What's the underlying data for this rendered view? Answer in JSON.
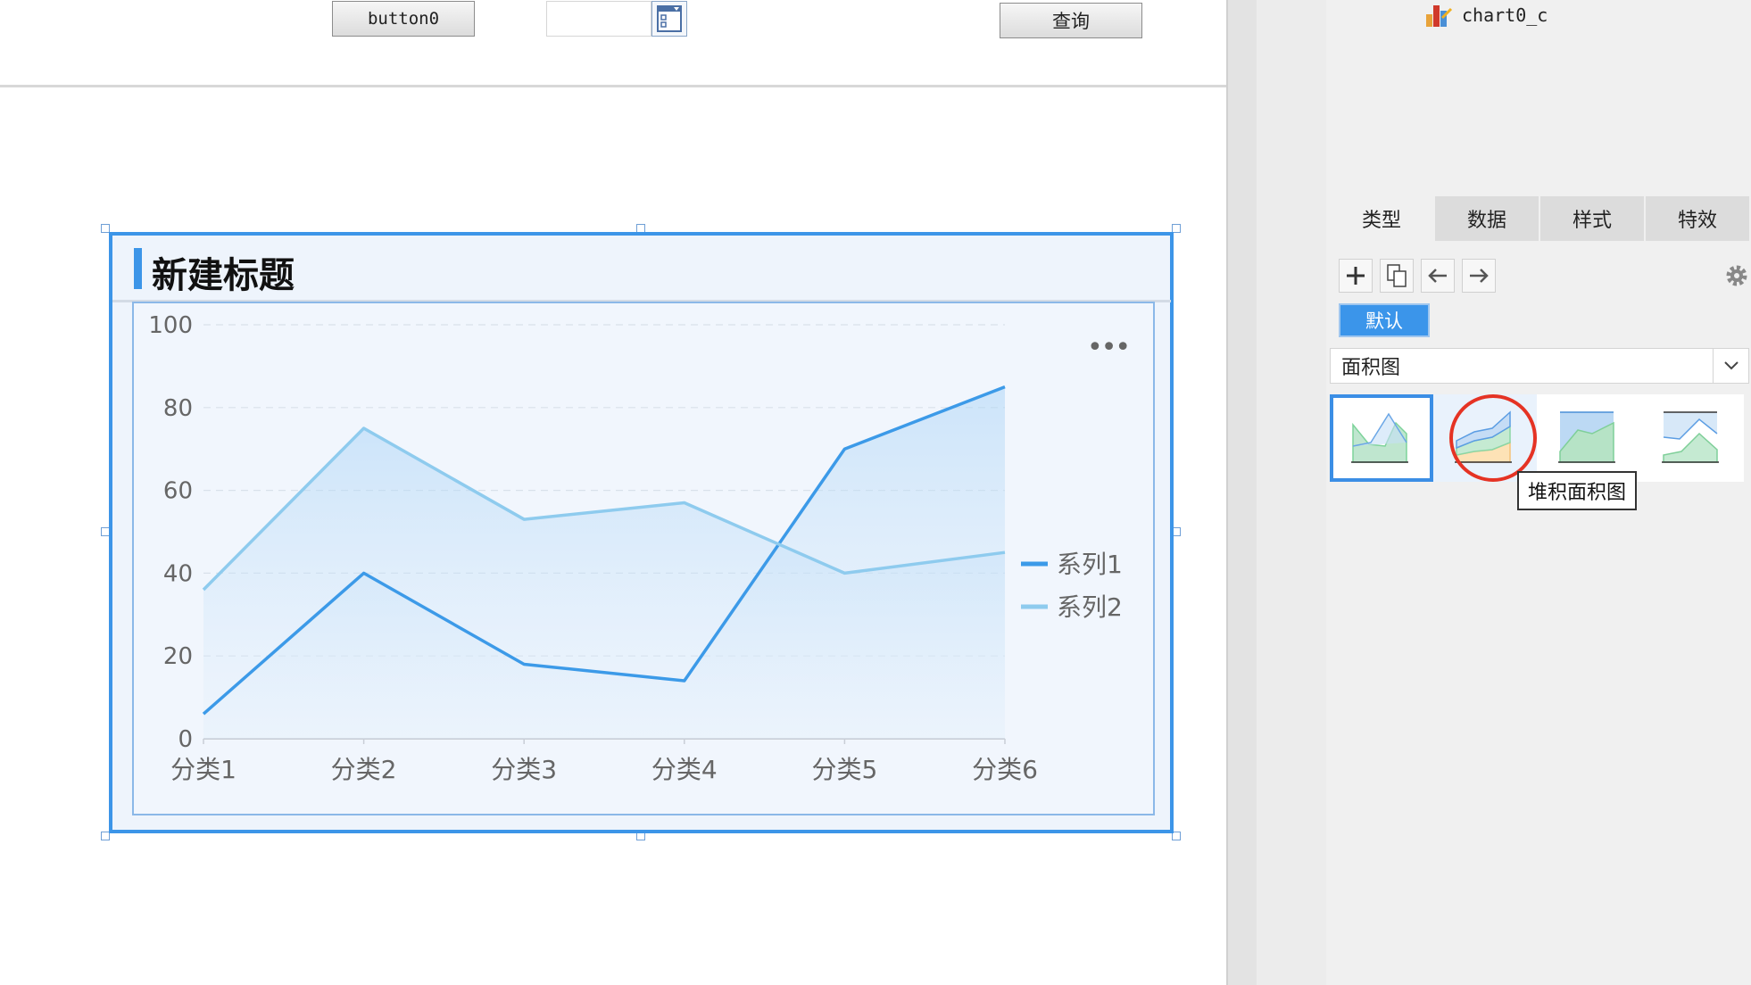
{
  "toolbar": {
    "button0_label": "button0",
    "query_label": "查询",
    "date_value": ""
  },
  "chart": {
    "title": "新建标题",
    "more_label": "•••"
  },
  "chart_data": {
    "type": "area",
    "categories": [
      "分类1",
      "分类2",
      "分类3",
      "分类4",
      "分类5",
      "分类6"
    ],
    "series": [
      {
        "name": "系列1",
        "values": [
          6,
          40,
          18,
          14,
          70,
          85
        ],
        "color": "#3c9ae8"
      },
      {
        "name": "系列2",
        "values": [
          36,
          75,
          53,
          57,
          40,
          45
        ],
        "color": "#8ecbee"
      }
    ],
    "ylim": [
      0,
      100
    ],
    "yticks": [
      0,
      20,
      40,
      60,
      80,
      100
    ],
    "grid": true,
    "legend": "right"
  },
  "panel": {
    "tree_item": "chart0_c",
    "tabs": [
      {
        "label": "类型",
        "active": true
      },
      {
        "label": "数据",
        "active": false
      },
      {
        "label": "样式",
        "active": false
      },
      {
        "label": "特效",
        "active": false
      }
    ],
    "tools": [
      "plus-icon",
      "copy-icon",
      "arrow-left-icon",
      "arrow-right-icon"
    ],
    "default_label": "默认",
    "chart_type_value": "面积图",
    "thumbnails": [
      "area-chart-thumb",
      "stacked-area-chart-thumb",
      "percent-area-chart-thumb",
      "area-line-chart-thumb"
    ],
    "tooltip": "堆积面积图"
  }
}
